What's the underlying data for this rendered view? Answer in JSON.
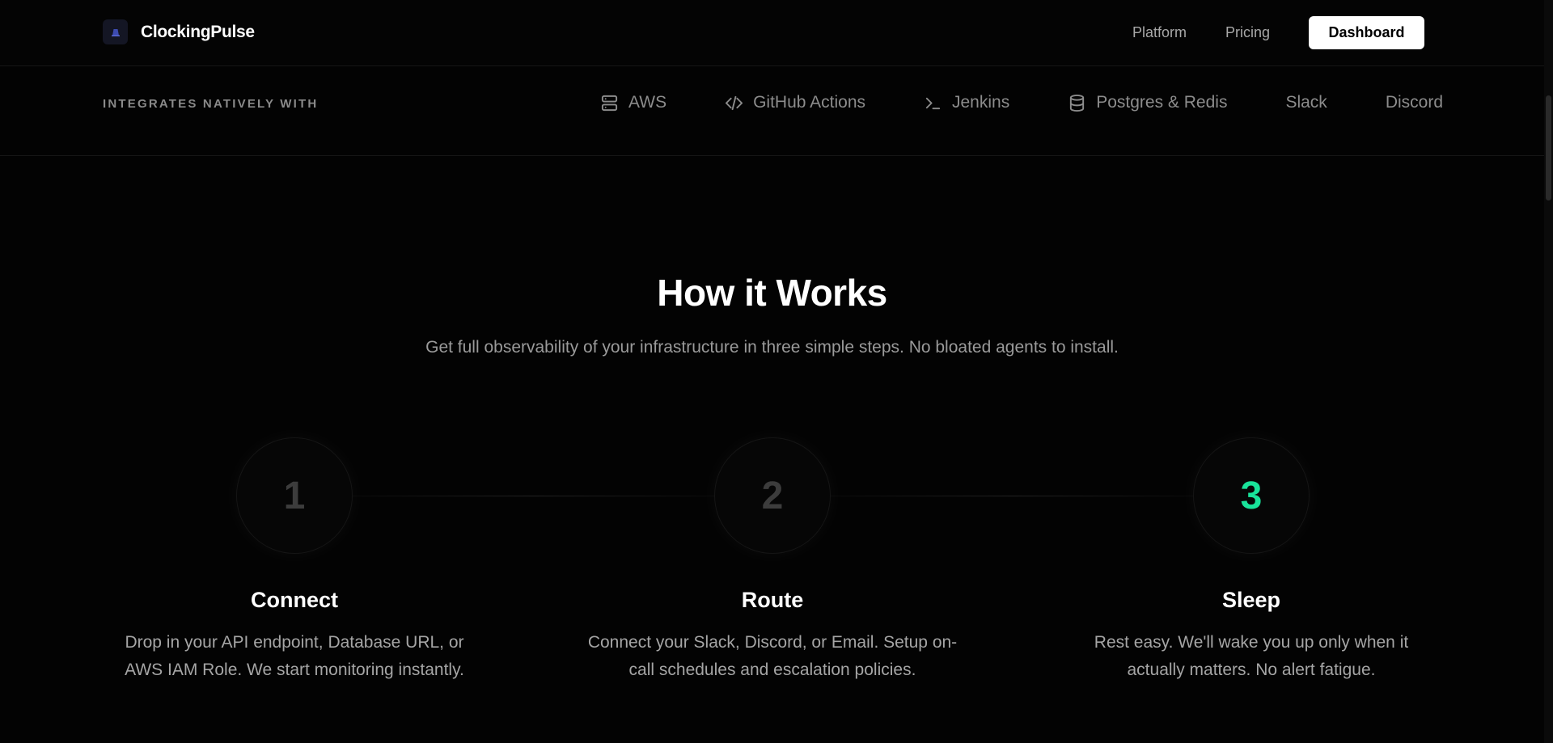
{
  "header": {
    "brand_name": "ClockingPulse",
    "brand_icon": "pulse-logo-icon",
    "nav": [
      {
        "label": "Platform"
      },
      {
        "label": "Pricing"
      }
    ],
    "dashboard_label": "Dashboard"
  },
  "integrations": {
    "label": "INTEGRATES NATIVELY WITH",
    "items": [
      {
        "label": "AWS",
        "icon": "server-icon"
      },
      {
        "label": "GitHub Actions",
        "icon": "code-icon"
      },
      {
        "label": "Jenkins",
        "icon": "terminal-icon"
      },
      {
        "label": "Postgres & Redis",
        "icon": "database-icon"
      },
      {
        "label": "Slack",
        "icon": ""
      },
      {
        "label": "Discord",
        "icon": ""
      }
    ]
  },
  "how_it_works": {
    "title": "How it Works",
    "subtitle": "Get full observability of your infrastructure in three simple steps. No bloated agents to install.",
    "steps": [
      {
        "number": "1",
        "title": "Connect",
        "description": "Drop in your API endpoint, Database URL, or AWS IAM Role. We start monitoring instantly."
      },
      {
        "number": "2",
        "title": "Route",
        "description": "Connect your Slack, Discord, or Email. Setup on-call schedules and escalation policies."
      },
      {
        "number": "3",
        "title": "Sleep",
        "description": "Rest easy. We'll wake you up only when it actually matters. No alert fatigue."
      }
    ]
  },
  "colors": {
    "background": "#030303",
    "accent": "#19e39a",
    "muted_text": "#a5a5a5"
  }
}
